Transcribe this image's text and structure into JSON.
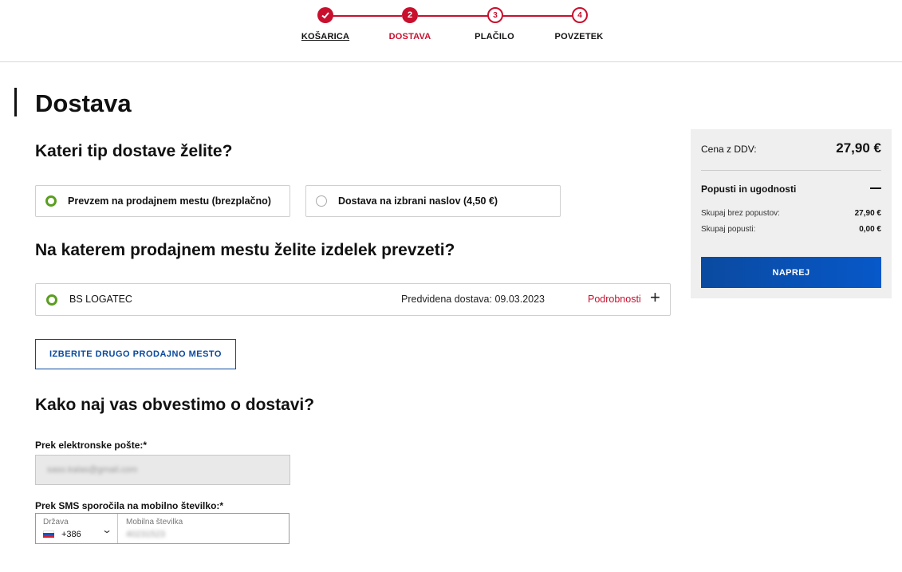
{
  "stepper": {
    "steps": [
      {
        "label": "KOŠARICA",
        "state": "done",
        "number": "1"
      },
      {
        "label": "DOSTAVA",
        "state": "active",
        "number": "2"
      },
      {
        "label": "PLAČILO",
        "state": "todo",
        "number": "3"
      },
      {
        "label": "POVZETEK",
        "state": "todo",
        "number": "4"
      }
    ]
  },
  "page": {
    "title": "Dostava"
  },
  "delivery_type": {
    "heading": "Kateri tip dostave želite?",
    "options": [
      {
        "label": "Prevzem na prodajnem mestu (brezplačno)",
        "selected": true
      },
      {
        "label": "Dostava na izbrani naslov (4,50 €)",
        "selected": false
      }
    ]
  },
  "store": {
    "heading": "Na katerem prodajnem mestu želite izdelek prevzeti?",
    "name": "BS LOGATEC",
    "delivery_estimate": "Predvidena dostava: 09.03.2023",
    "details_link": "Podrobnosti",
    "change_button": "IZBERITE DRUGO PRODAJNO MESTO"
  },
  "notify": {
    "heading": "Kako naj vas obvestimo o dostavi?",
    "email_label": "Prek elektronske pošte:*",
    "email_value": "saso.kalas@gmail.com",
    "sms_label": "Prek SMS sporočila na mobilno številko:*",
    "country_label": "Država",
    "country_code": "+386",
    "phone_label": "Mobilna številka",
    "phone_value": "40231523"
  },
  "summary": {
    "price_label": "Cena z DDV:",
    "price": "27,90 €",
    "discounts_title": "Popusti in ugodnosti",
    "without_discounts_label": "Skupaj brez popustov:",
    "without_discounts_value": "27,90 €",
    "discounts_label": "Skupaj popusti:",
    "discounts_value": "0,00 €",
    "next_button": "NAPREJ"
  },
  "colors": {
    "accent": "#c8102e",
    "primary": "#0a4aa0",
    "selected_radio": "#5a9e1f"
  }
}
